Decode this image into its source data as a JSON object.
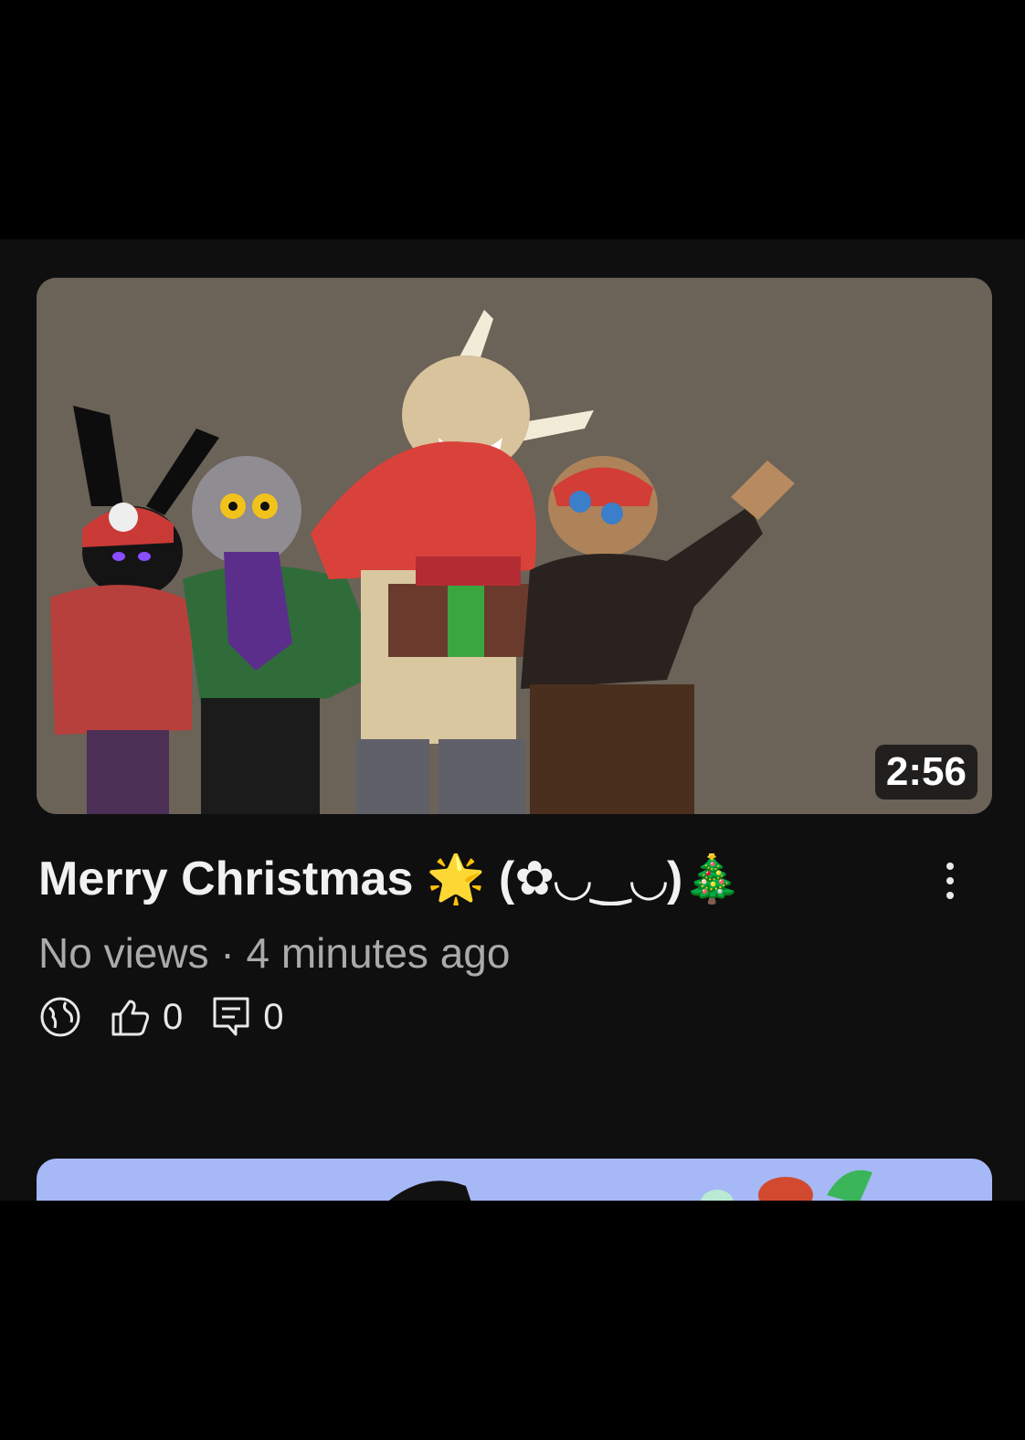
{
  "video": {
    "duration": "2:56",
    "title": "Merry Christmas 🌟 (✿◡‿◡)🎄",
    "meta": "No views · 4 minutes ago",
    "likes": "0",
    "comments": "0"
  },
  "icons": {
    "visibility": "globe-icon",
    "likes": "thumbs-up-icon",
    "comments": "comment-icon",
    "menu": "more-vertical-icon"
  },
  "colors": {
    "background": "#0f0f0f",
    "thumbnail_bg": "#6b6258",
    "next_thumbnail_bg": "#a6b8f6",
    "meta_text": "#aaaaaa"
  }
}
